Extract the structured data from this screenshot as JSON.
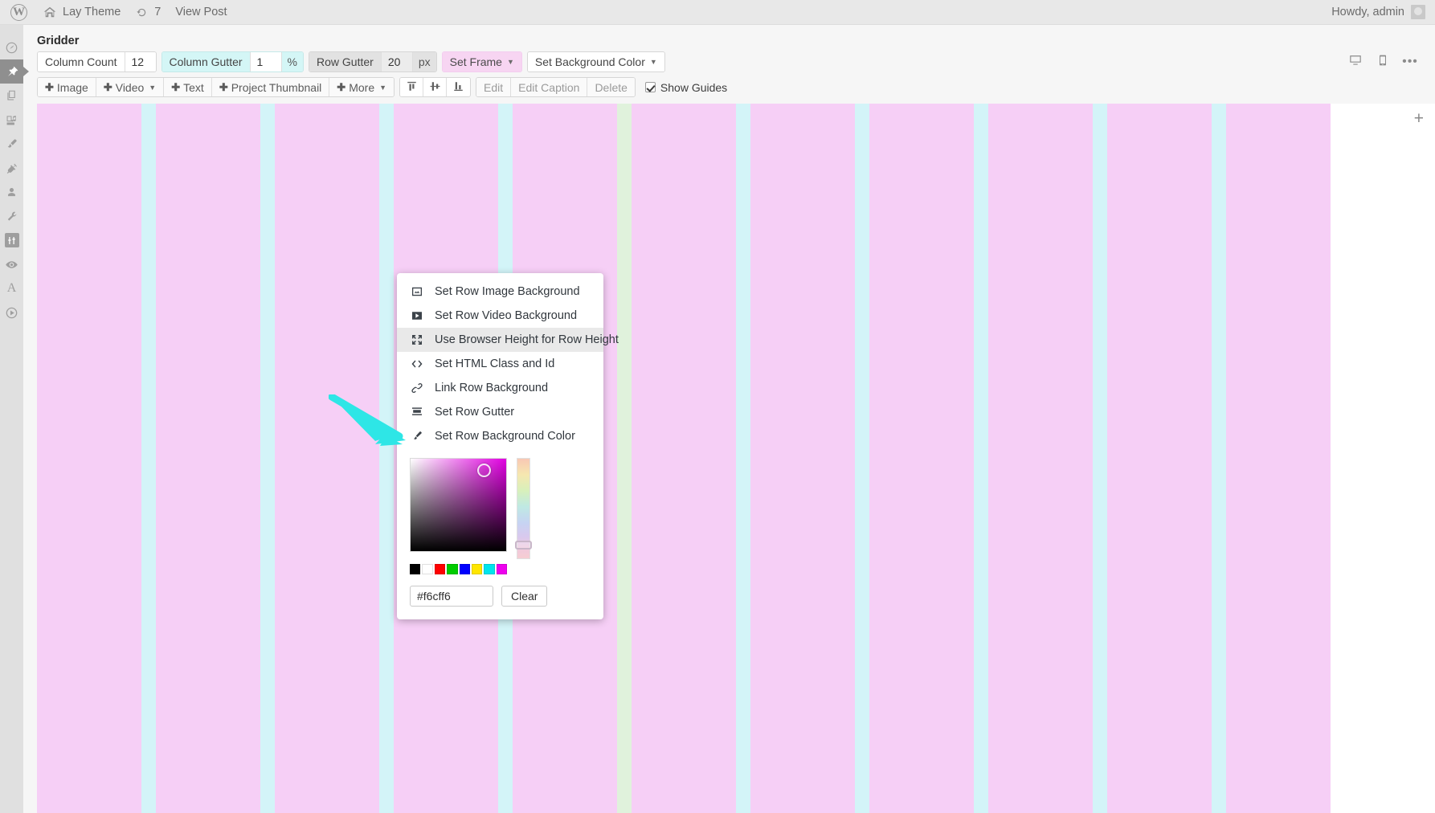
{
  "adminbar": {
    "logo_icon": "wordpress-logo-icon",
    "home_icon": "home-icon",
    "site_name": "Lay Theme",
    "revisions_icon": "revisions-icon",
    "revisions_count": "7",
    "view_post": "View Post",
    "howdy": "Howdy, admin",
    "avatar": "avatar"
  },
  "sidebar": {
    "items": [
      {
        "name": "dashboard",
        "icon": "dashboard-icon"
      },
      {
        "name": "posts",
        "icon": "pin-icon",
        "active": true
      },
      {
        "name": "pages",
        "icon": "pages-icon"
      },
      {
        "name": "media",
        "icon": "media-icon"
      },
      {
        "name": "appearance",
        "icon": "brush-icon"
      },
      {
        "name": "plugins",
        "icon": "plug-icon"
      },
      {
        "name": "users",
        "icon": "user-icon"
      },
      {
        "name": "tools",
        "icon": "wrench-icon"
      },
      {
        "name": "settings",
        "icon": "sliders-icon"
      },
      {
        "name": "preview",
        "icon": "eye-icon"
      },
      {
        "name": "typography",
        "icon": "letter-a-icon"
      },
      {
        "name": "media-player",
        "icon": "play-circle-icon"
      }
    ]
  },
  "panel": {
    "title": "Gridder",
    "toolbar1": {
      "column_count_label": "Column Count",
      "column_count_value": "12",
      "column_gutter_label": "Column Gutter",
      "column_gutter_value": "1",
      "column_gutter_unit": "%",
      "row_gutter_label": "Row Gutter",
      "row_gutter_value": "20",
      "row_gutter_unit": "px",
      "set_frame": "Set Frame",
      "set_background_color": "Set Background Color"
    },
    "toolbar2": {
      "add_image": "Image",
      "add_video": "Video",
      "add_text": "Text",
      "add_project_thumbnail": "Project Thumbnail",
      "add_more": "More",
      "align_top_icon": "align-top-icon",
      "align_middle_icon": "align-middle-icon",
      "align_bottom_icon": "align-bottom-icon",
      "edit": "Edit",
      "edit_caption": "Edit Caption",
      "delete": "Delete",
      "show_guides": "Show Guides",
      "show_guides_checked": true
    },
    "devices": {
      "desktop_icon": "desktop-icon",
      "mobile_icon": "mobile-icon",
      "more_icon": "ellipsis-icon"
    },
    "canvas": {
      "add_row_label": "+",
      "column_color": "#f6cff6",
      "gutter_color": "#d3f4f8",
      "highlight_gutter_color": "#e0f2dc"
    }
  },
  "context_menu": {
    "items": [
      {
        "label": "Set Row Image Background",
        "icon": "image-icon",
        "highlighted": false
      },
      {
        "label": "Set Row Video Background",
        "icon": "video-icon",
        "highlighted": false
      },
      {
        "label": "Use Browser Height for Row Height",
        "icon": "expand-icon",
        "highlighted": true
      },
      {
        "label": "Set HTML Class and Id",
        "icon": "code-icon",
        "highlighted": false
      },
      {
        "label": "Link Row Background",
        "icon": "link-icon",
        "highlighted": false
      },
      {
        "label": "Set Row Gutter",
        "icon": "rows-icon",
        "highlighted": false
      },
      {
        "label": "Set Row Background Color",
        "icon": "brush-icon",
        "highlighted": false
      }
    ],
    "color_picker": {
      "hex_value": "#f6cff6",
      "clear_label": "Clear",
      "saturation_icon": "saturation-value-area",
      "hue_icon": "hue-slider",
      "swatches": [
        "#000000",
        "#ffffff",
        "#ff0000",
        "#00cc00",
        "#0000ff",
        "#ffe600",
        "#00e5ee",
        "#ee00ee"
      ]
    }
  },
  "annotation": {
    "arrow_icon": "cyan-arrow-pointer",
    "color": "#2ee6e6"
  }
}
